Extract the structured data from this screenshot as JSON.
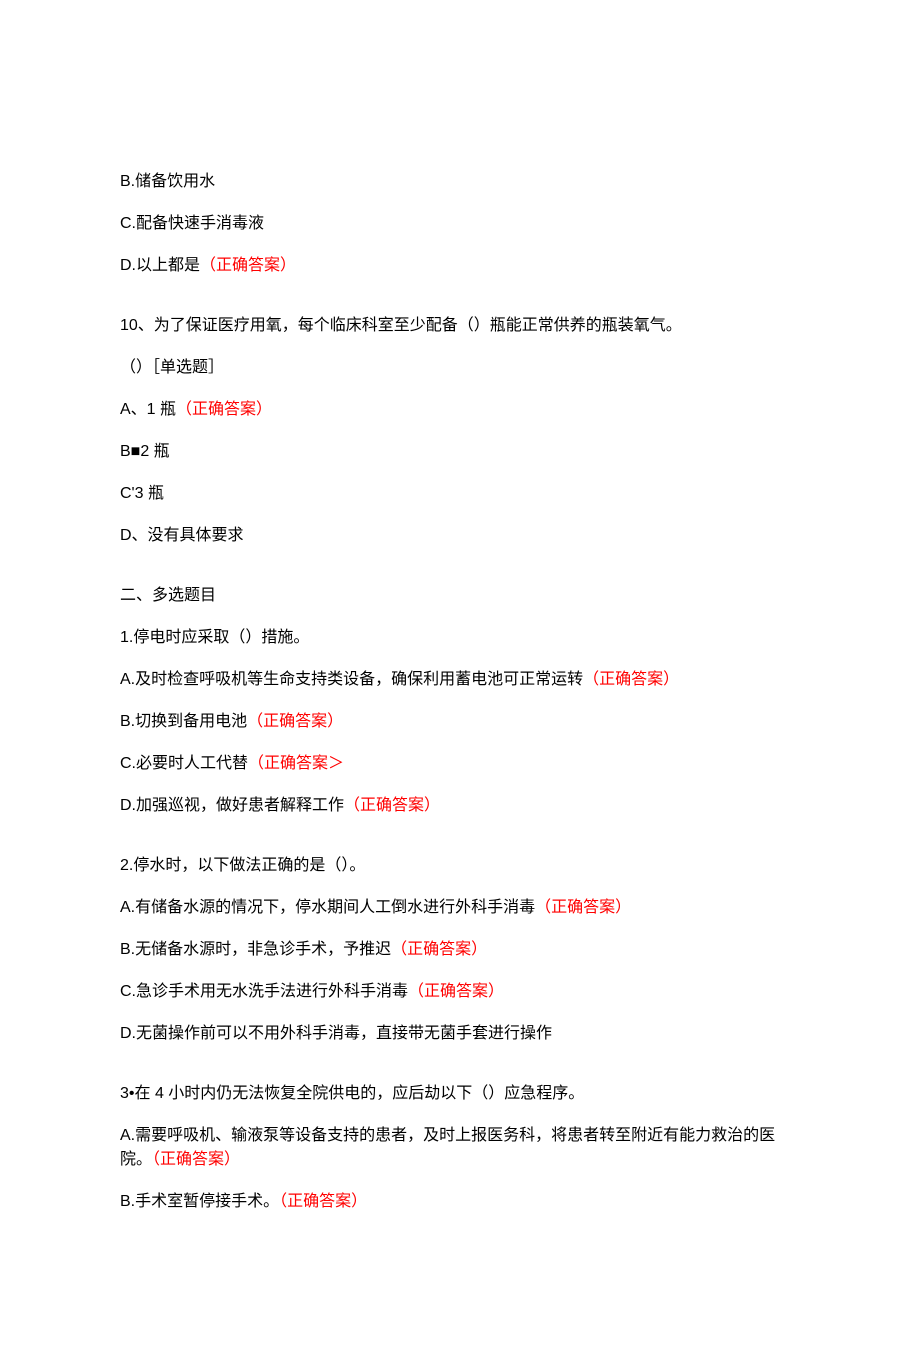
{
  "correctLabel": "（正确答案）",
  "correctLabelAlt": "（正确答案＞",
  "partial": {
    "b": "B.储备饮用水",
    "c": "C.配备快速手消毒液",
    "d_prefix": "D.以上都是"
  },
  "q10": {
    "stem_line1": "10、为了保证医疗用氧，每个临床科室至少配备（）瓶能正常供养的瓶装氧气。",
    "stem_line2": "（）［单选题］",
    "a_prefix": "A、1 瓶",
    "b": "B■2 瓶",
    "c": "C'3 瓶",
    "d": "D、没有具体要求"
  },
  "section2": {
    "title": "二、多选题目"
  },
  "m1": {
    "stem": "1.停电时应采取（）措施。",
    "a_prefix": "A.及时检查呼吸机等生命支持类设备，确保利用蓄电池可正常运转",
    "b_prefix": "B.切换到备用电池",
    "c_prefix": "C.必要时人工代替",
    "d_prefix": "D.加强巡视，做好患者解释工作"
  },
  "m2": {
    "stem": "2.停水时，以下做法正确的是（）。",
    "a_prefix": "A.有储备水源的情况下，停水期间人工倒水进行外科手消毒",
    "b_prefix": "B.无储备水源时，非急诊手术，予推迟",
    "c_prefix": "C.急诊手术用无水洗手法进行外科手消毒",
    "d": "D.无菌操作前可以不用外科手消毒，直接带无菌手套进行操作"
  },
  "m3": {
    "stem": "3•在 4 小时内仍无法恢复全院供电的，应后劫以下（）应急程序。",
    "a_prefix": "A.需要呼吸机、输液泵等设备支持的患者，及时上报医务科，将患者转至附近有能力救治的医院。",
    "b_prefix": "B.手术室暂停接手术。"
  }
}
